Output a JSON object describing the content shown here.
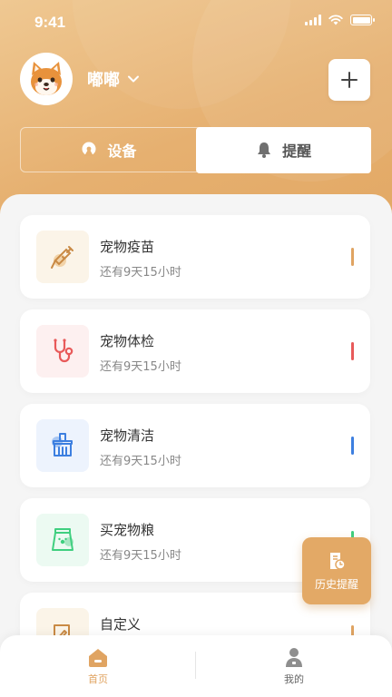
{
  "status_bar": {
    "time": "9:41"
  },
  "profile": {
    "name": "嘟嘟"
  },
  "segments": [
    {
      "label": "设备",
      "active": false
    },
    {
      "label": "提醒",
      "active": true
    }
  ],
  "reminders": [
    {
      "title": "宠物疫苗",
      "subtitle": "还有9天15小时",
      "icon": "syringe-icon",
      "accent": "#e0a462",
      "icon_bg": "#fbf4e8"
    },
    {
      "title": "宠物体检",
      "subtitle": "还有9天15小时",
      "icon": "stethoscope-icon",
      "accent": "#e85a5a",
      "icon_bg": "#fdf0f0"
    },
    {
      "title": "宠物清洁",
      "subtitle": "还有9天15小时",
      "icon": "brush-icon",
      "accent": "#3d7fe0",
      "icon_bg": "#edf3fd"
    },
    {
      "title": "买宠物粮",
      "subtitle": "还有9天15小时",
      "icon": "food-bag-icon",
      "accent": "#3fcf7f",
      "icon_bg": "#ecfaf2"
    },
    {
      "title": "自定义",
      "subtitle": "",
      "icon": "edit-icon",
      "accent": "#e0a462",
      "icon_bg": "#fbf4e8"
    }
  ],
  "fab": {
    "label": "历史提醒"
  },
  "tabbar": [
    {
      "label": "首页",
      "active": true
    },
    {
      "label": "我的",
      "active": false
    }
  ],
  "colors": {
    "brand": "#e3a966",
    "header": "#e6b070"
  }
}
